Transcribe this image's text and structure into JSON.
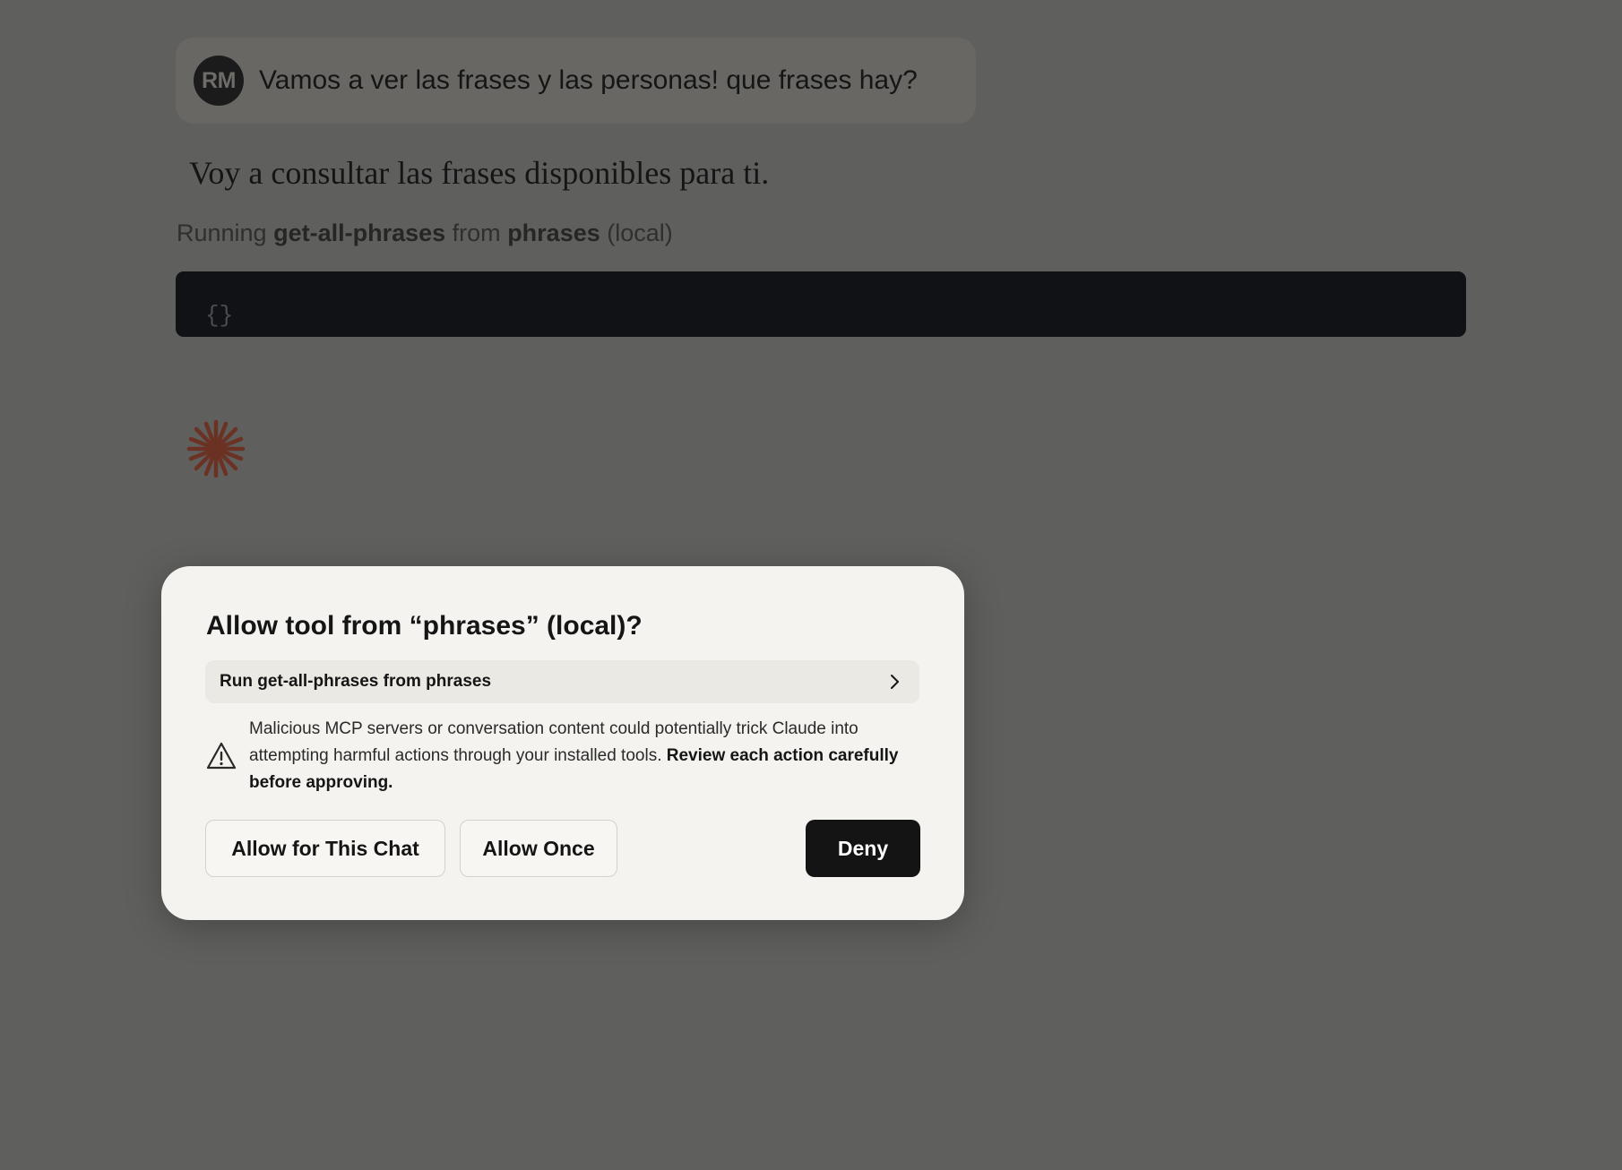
{
  "chat": {
    "user_avatar": "RM",
    "user_message": "Vamos a ver las frases y las personas! que frases hay?",
    "assistant_message": "Voy a consultar las frases disponibles para ti.",
    "running": {
      "prefix": "Running",
      "tool_name": "get-all-phrases",
      "middle": "from",
      "server_name": "phrases",
      "suffix": "(local)"
    },
    "code_content": "{}",
    "loading_icon": "spark-icon"
  },
  "dialog": {
    "title": "Allow tool from “phrases” (local)?",
    "tool_row_label": "Run get-all-phrases from phrases",
    "tool_row_icon": "chevron-right-icon",
    "warning_icon": "warning-triangle-icon",
    "warning_text": "Malicious MCP servers or conversation content could potentially trick Claude into attempting harmful actions through your installed tools.",
    "warning_emphasis": "Review each action carefully before approving.",
    "buttons": {
      "allow_chat": "Allow for This Chat",
      "allow_once": "Allow Once",
      "deny": "Deny"
    }
  },
  "colors": {
    "backdrop": "#5f5f5d",
    "dialog_bg": "#f4f3ef",
    "deny_bg": "#141414",
    "code_bg": "#111216",
    "spark": "#6b3224"
  }
}
